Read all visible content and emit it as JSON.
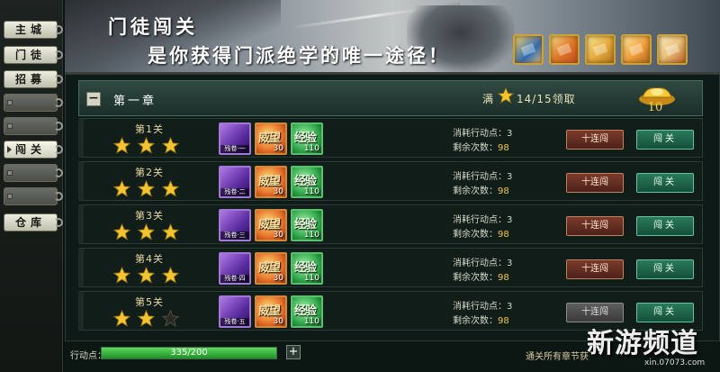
{
  "nav": {
    "items": [
      {
        "label": "主城",
        "state": "normal"
      },
      {
        "label": "门徒",
        "state": "normal"
      },
      {
        "label": "招募",
        "state": "normal"
      },
      {
        "label": "",
        "state": "locked"
      },
      {
        "label": "",
        "state": "locked"
      },
      {
        "label": "闯关",
        "state": "active"
      },
      {
        "label": "",
        "state": "locked"
      },
      {
        "label": "",
        "state": "locked"
      },
      {
        "label": "仓库",
        "state": "normal"
      }
    ]
  },
  "banner": {
    "title": "门徒闯关",
    "subtitle": "是你获得门派绝学的唯一途径！",
    "reward_icons": [
      "blue-scroll-icon",
      "red-book-icon",
      "gold-scroll-icon",
      "orange-manual-icon",
      "strip-scroll-icon"
    ]
  },
  "chapter": {
    "collapse_symbol": "−",
    "title": "第一章",
    "full_label": "满",
    "progress_text": "14/15领取",
    "gold_count": "10"
  },
  "levels": [
    {
      "name": "第1关",
      "stars": 3,
      "box_tag": "残卷·一",
      "fame_qty": "30",
      "exp_qty": "110",
      "cost_label": "消耗行动点：",
      "cost_value": "3",
      "remaining_label": "剩余次数：",
      "remaining_value": "98",
      "sweep_label": "十连闯",
      "sweep_enabled": true,
      "challenge_label": "闯关"
    },
    {
      "name": "第2关",
      "stars": 3,
      "box_tag": "残卷·二",
      "fame_qty": "30",
      "exp_qty": "110",
      "cost_label": "消耗行动点：",
      "cost_value": "3",
      "remaining_label": "剩余次数：",
      "remaining_value": "98",
      "sweep_label": "十连闯",
      "sweep_enabled": true,
      "challenge_label": "闯关"
    },
    {
      "name": "第3关",
      "stars": 3,
      "box_tag": "残卷·三",
      "fame_qty": "30",
      "exp_qty": "110",
      "cost_label": "消耗行动点：",
      "cost_value": "3",
      "remaining_label": "剩余次数：",
      "remaining_value": "98",
      "sweep_label": "十连闯",
      "sweep_enabled": true,
      "challenge_label": "闯关"
    },
    {
      "name": "第4关",
      "stars": 3,
      "box_tag": "残卷·四",
      "fame_qty": "30",
      "exp_qty": "110",
      "cost_label": "消耗行动点：",
      "cost_value": "3",
      "remaining_label": "剩余次数：",
      "remaining_value": "98",
      "sweep_label": "十连闯",
      "sweep_enabled": true,
      "challenge_label": "闯关"
    },
    {
      "name": "第5关",
      "stars": 2,
      "box_tag": "残卷·五",
      "fame_qty": "30",
      "exp_qty": "110",
      "cost_label": "消耗行动点：",
      "cost_value": "3",
      "remaining_label": "剩余次数：",
      "remaining_value": "98",
      "sweep_label": "十连闯",
      "sweep_enabled": false,
      "challenge_label": "闯关"
    }
  ],
  "item_glyphs": {
    "fame": "威望",
    "exp": "经验"
  },
  "bottom": {
    "ap_label": "行动点：",
    "ap_value": "335/200",
    "ap_fill_fraction": 1.0,
    "plus_symbol": "+",
    "footer_note": "通关所有章节获"
  },
  "watermark": {
    "text": "新游频道",
    "sub": "xin.07073.com"
  },
  "colors": {
    "star_gold": "#f4c430",
    "star_empty": "#2a2a22",
    "accent_green": "#2a7a5a",
    "accent_red": "#7a3a2a"
  }
}
